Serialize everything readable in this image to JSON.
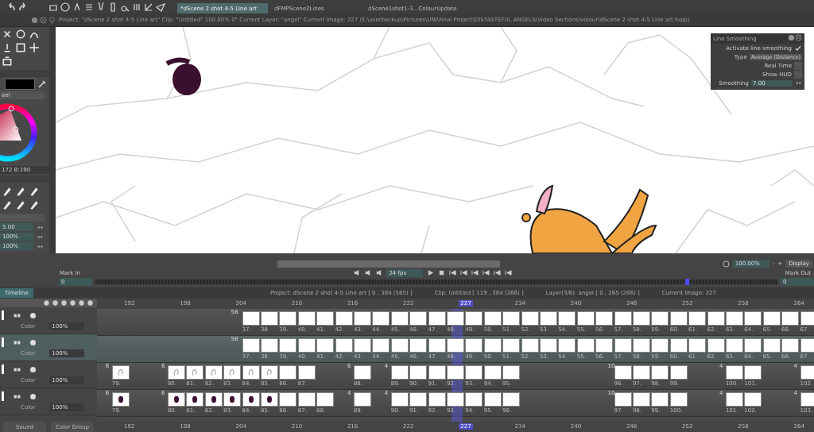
{
  "tabs": [
    {
      "label": "*dScene 2 shot 4-5 Line art",
      "selected": true
    },
    {
      "label": "dFMPScene2Lines",
      "selected": false
    },
    {
      "label": "dScene1shot1-3...ColourUpdate",
      "selected": false
    }
  ],
  "info_bar": "Project:  \"dScene 2 shot 4-5 Line art\"  Clip: \"Untitled\"   100.00%  0°  Current Layer: \"angel\"  Current Image: 227 (E:\\userbackup\\Pictures\\UNI\\Final Project\\DISTASTEFUL ANGELS\\Video Sections\\volour\\dScene 2 shot 4-5 Line art.tvpp)",
  "color_panel": {
    "mode": "eel",
    "readout": "172 B:190"
  },
  "brush_panel": {
    "fields": [
      "5.00",
      "100%",
      "100%"
    ]
  },
  "line_smoothing": {
    "title": "Line Smoothing",
    "rows": [
      {
        "kind": "check",
        "label": "Activate line smoothing",
        "checked": true
      },
      {
        "kind": "select",
        "label": "Type",
        "value": "Average (Distance)"
      },
      {
        "kind": "check",
        "label": "Real Time",
        "checked": false
      },
      {
        "kind": "check",
        "label": "Show HUD",
        "checked": false
      },
      {
        "kind": "number",
        "label": "Smoothing",
        "value": "7.00"
      }
    ]
  },
  "view_bar": {
    "zoom": "100.00%",
    "minus": "-",
    "plus": "+",
    "display": "Display"
  },
  "playback": {
    "mark_in": "Mark In",
    "mark_in_value": "0",
    "fps": "24 fps",
    "mark_out": "Mark Out",
    "mark_out_value": "0",
    "playhead": {
      "level": 0.865
    }
  },
  "timeline_tab": "Timeline",
  "status": [
    "Project: dScene 2 shot 4-5 Line art [ 0 , 384  (585) ]",
    "Clip: Untitled [ 119 , 384  (266) ]",
    "Layer(3/6): angel [ 0 , 265  (266) ]",
    "Current Image: 227"
  ],
  "ruler": [
    {
      "label": "192",
      "selected": false
    },
    {
      "label": "198",
      "selected": false
    },
    {
      "label": "204",
      "selected": false
    },
    {
      "label": "210",
      "selected": false
    },
    {
      "label": "216",
      "selected": false
    },
    {
      "label": "222",
      "selected": false
    },
    {
      "label": "227",
      "selected": true
    },
    {
      "label": "234",
      "selected": false
    },
    {
      "label": "240",
      "selected": false
    },
    {
      "label": "246",
      "selected": false
    },
    {
      "label": "252",
      "selected": false
    },
    {
      "label": "258",
      "selected": false
    },
    {
      "label": "264",
      "selected": false
    }
  ],
  "layers": [
    {
      "selected": false,
      "mode": "Color",
      "opacity": "100%",
      "hold": "58",
      "cels": [
        {
          "label": "37.",
          "kind": "blank"
        },
        {
          "label": "38.",
          "kind": "blank"
        },
        {
          "label": "39.",
          "kind": "blank"
        },
        {
          "label": "40.",
          "kind": "blank"
        },
        {
          "label": "41.",
          "kind": "blank"
        },
        {
          "label": "42.",
          "kind": "blank"
        },
        {
          "label": "43.",
          "kind": "blank"
        },
        {
          "label": "44.",
          "kind": "blank"
        },
        {
          "label": "45.",
          "kind": "blank"
        },
        {
          "label": "46.",
          "kind": "blank"
        },
        {
          "label": "47.",
          "kind": "blank"
        },
        {
          "label": "48.",
          "kind": "blank"
        },
        {
          "label": "49.",
          "kind": "blank"
        },
        {
          "label": "50.",
          "kind": "blank"
        },
        {
          "label": "51.",
          "kind": "blank"
        },
        {
          "label": "52.",
          "kind": "blank"
        },
        {
          "label": "53.",
          "kind": "blank"
        },
        {
          "label": "54.",
          "kind": "blank"
        },
        {
          "label": "55.",
          "kind": "blank"
        },
        {
          "label": "56.",
          "kind": "blank"
        },
        {
          "label": "57.",
          "kind": "blank"
        },
        {
          "label": "58.",
          "kind": "blank"
        },
        {
          "label": "59.",
          "kind": "blank"
        },
        {
          "label": "60.",
          "kind": "blank"
        },
        {
          "label": "61.",
          "kind": "blank"
        },
        {
          "label": "62.",
          "kind": "blank"
        },
        {
          "label": "63.",
          "kind": "blank"
        },
        {
          "label": "64.",
          "kind": "blank"
        },
        {
          "label": "65.",
          "kind": "blank"
        },
        {
          "label": "66.",
          "kind": "blank"
        },
        {
          "label": "67.",
          "kind": "blank"
        }
      ]
    },
    {
      "selected": true,
      "mode": "Color",
      "opacity": "100%",
      "hold": "58",
      "cels": [
        {
          "label": "37.",
          "kind": "blank"
        },
        {
          "label": "38.",
          "kind": "blank"
        },
        {
          "label": "39.",
          "kind": "blank"
        },
        {
          "label": "40.",
          "kind": "blank"
        },
        {
          "label": "41.",
          "kind": "blank"
        },
        {
          "label": "42.",
          "kind": "blank"
        },
        {
          "label": "43.",
          "kind": "blank"
        },
        {
          "label": "44.",
          "kind": "blank"
        },
        {
          "label": "45.",
          "kind": "blank"
        },
        {
          "label": "46.",
          "kind": "blank"
        },
        {
          "label": "47.",
          "kind": "blank"
        },
        {
          "label": "48.",
          "kind": "blank"
        },
        {
          "label": "49.",
          "kind": "blank"
        },
        {
          "label": "50.",
          "kind": "blank"
        },
        {
          "label": "51.",
          "kind": "blank"
        },
        {
          "label": "52.",
          "kind": "blank"
        },
        {
          "label": "53.",
          "kind": "blank"
        },
        {
          "label": "54.",
          "kind": "blank"
        },
        {
          "label": "55.",
          "kind": "blank"
        },
        {
          "label": "56.",
          "kind": "blank"
        },
        {
          "label": "57.",
          "kind": "blank"
        },
        {
          "label": "58.",
          "kind": "blank"
        },
        {
          "label": "59.",
          "kind": "blank"
        },
        {
          "label": "60.",
          "kind": "blank"
        },
        {
          "label": "61.",
          "kind": "blank"
        },
        {
          "label": "62.",
          "kind": "blank"
        },
        {
          "label": "63.",
          "kind": "blank"
        },
        {
          "label": "64.",
          "kind": "blank"
        },
        {
          "label": "65.",
          "kind": "blank"
        },
        {
          "label": "66.",
          "kind": "blank"
        },
        {
          "label": "67.",
          "kind": "blank"
        }
      ]
    },
    {
      "selected": false,
      "mode": "Color",
      "opacity": "100%",
      "cels": [
        {
          "label": "79.",
          "kind": "sketch",
          "hold": "6"
        },
        {
          "label": "80.",
          "kind": "sketch",
          "hold": "6"
        },
        {
          "label": "81.",
          "kind": "sketch"
        },
        {
          "label": "82.",
          "kind": "sketch"
        },
        {
          "label": "83.",
          "kind": "sketch"
        },
        {
          "label": "84.",
          "kind": "sketch"
        },
        {
          "label": "85.",
          "kind": "sketch"
        },
        {
          "label": "86.",
          "kind": "blank"
        },
        {
          "label": "87.",
          "kind": "blank"
        },
        {
          "label": "88.",
          "kind": "blank",
          "hold": "6"
        },
        {
          "label": "89.",
          "kind": "blank",
          "hold": "4"
        },
        {
          "label": "90.",
          "kind": "blank"
        },
        {
          "label": "91.",
          "kind": "blank"
        },
        {
          "label": "92.",
          "kind": "blank"
        },
        {
          "label": "93.",
          "kind": "blank"
        },
        {
          "label": "94.",
          "kind": "blank"
        },
        {
          "label": "95.",
          "kind": "blank"
        },
        {
          "label": "96.",
          "kind": "blank",
          "hold": "10"
        },
        {
          "label": "97.",
          "kind": "blank"
        },
        {
          "label": "98.",
          "kind": "blank"
        },
        {
          "label": "99.",
          "kind": "blank"
        },
        {
          "label": "100.",
          "kind": "blank",
          "hold": "4"
        },
        {
          "label": "101.",
          "kind": "blank"
        },
        {
          "label": "102.",
          "kind": "blank",
          "hold": "4"
        }
      ]
    },
    {
      "selected": false,
      "mode": "Color",
      "opacity": "100%",
      "cels": [
        {
          "label": "79.",
          "kind": "figure",
          "hold": "6"
        },
        {
          "label": "80.",
          "kind": "figure",
          "hold": "6"
        },
        {
          "label": "81.",
          "kind": "figure"
        },
        {
          "label": "82.",
          "kind": "figure"
        },
        {
          "label": "83.",
          "kind": "figure"
        },
        {
          "label": "84.",
          "kind": "figure"
        },
        {
          "label": "85.",
          "kind": "figure"
        },
        {
          "label": "86.",
          "kind": "blank"
        },
        {
          "label": "87.",
          "kind": "blank"
        },
        {
          "label": "88.",
          "kind": "blank"
        },
        {
          "label": "89.",
          "kind": "blank",
          "hold": "4"
        },
        {
          "label": "90.",
          "kind": "blank",
          "hold": "4"
        },
        {
          "label": "91.",
          "kind": "blank"
        },
        {
          "label": "92.",
          "kind": "blank"
        },
        {
          "label": "93.",
          "kind": "blank"
        },
        {
          "label": "94.",
          "kind": "blank"
        },
        {
          "label": "95.",
          "kind": "blank"
        },
        {
          "label": "96.",
          "kind": "blank"
        },
        {
          "label": "97.",
          "kind": "blank",
          "hold": "10"
        },
        {
          "label": "98.",
          "kind": "blank"
        },
        {
          "label": "99.",
          "kind": "blank"
        },
        {
          "label": "100.",
          "kind": "blank"
        },
        {
          "label": "101.",
          "kind": "blank",
          "hold": "4"
        },
        {
          "label": "102.",
          "kind": "blank"
        },
        {
          "label": "103.",
          "kind": "blank",
          "hold": "4"
        }
      ]
    }
  ],
  "bottom_ruler": [
    {
      "label": "192",
      "selected": false
    },
    {
      "label": "198",
      "selected": false
    },
    {
      "label": "204",
      "selected": false
    },
    {
      "label": "210",
      "selected": false
    },
    {
      "label": "216",
      "selected": false
    },
    {
      "label": "222",
      "selected": false
    },
    {
      "label": "227",
      "selected": true
    },
    {
      "label": "234",
      "selected": false
    },
    {
      "label": "240",
      "selected": false
    },
    {
      "label": "246",
      "selected": false
    },
    {
      "label": "252",
      "selected": false
    },
    {
      "label": "258",
      "selected": false
    },
    {
      "label": "264",
      "selected": false
    }
  ],
  "bottom_tabs": [
    "Sound",
    "Color Group"
  ]
}
